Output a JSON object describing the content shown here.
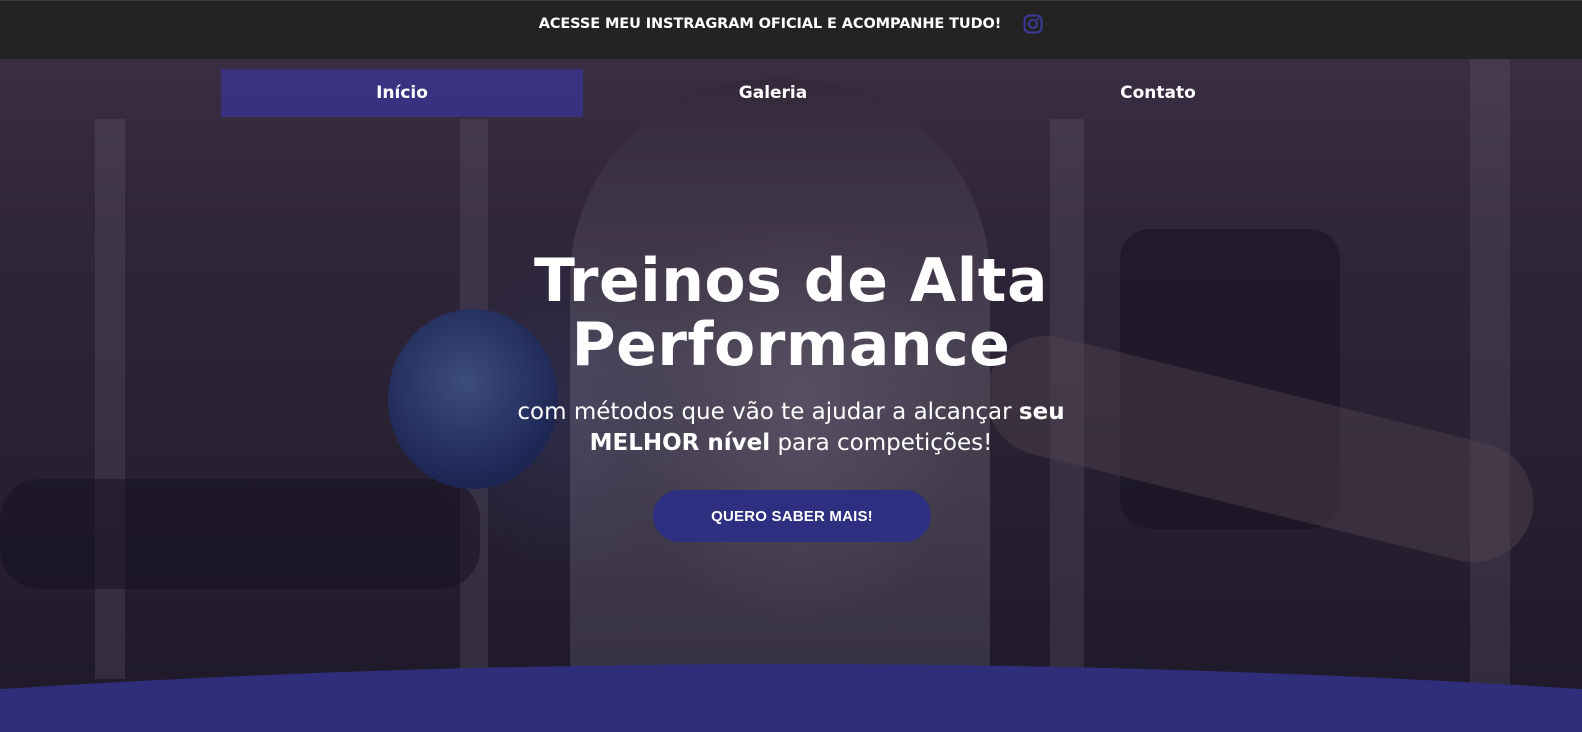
{
  "topbar": {
    "text": "ACESSE MEU INSTRAGRAM OFICIAL E ACOMPANHE TUDO!",
    "icon": "instagram-icon"
  },
  "nav": {
    "items": [
      {
        "label": "Início",
        "active": true
      },
      {
        "label": "Galeria",
        "active": false
      },
      {
        "label": "Contato",
        "active": false
      }
    ]
  },
  "hero": {
    "title_line1": "Treinos de Alta",
    "title_line2": "Performance",
    "subtitle_part1": "com métodos que vão te ajudar a alcançar ",
    "subtitle_bold1": "seu",
    "subtitle_bold2": "MELHOR nível",
    "subtitle_part2": " para competições!",
    "cta_label": "QUERO SABER MAIS!"
  },
  "colors": {
    "topbar_bg": "#232323",
    "accent": "#2f2f82",
    "nav_active": "#3a3496",
    "wave": "#2e2e7a"
  }
}
